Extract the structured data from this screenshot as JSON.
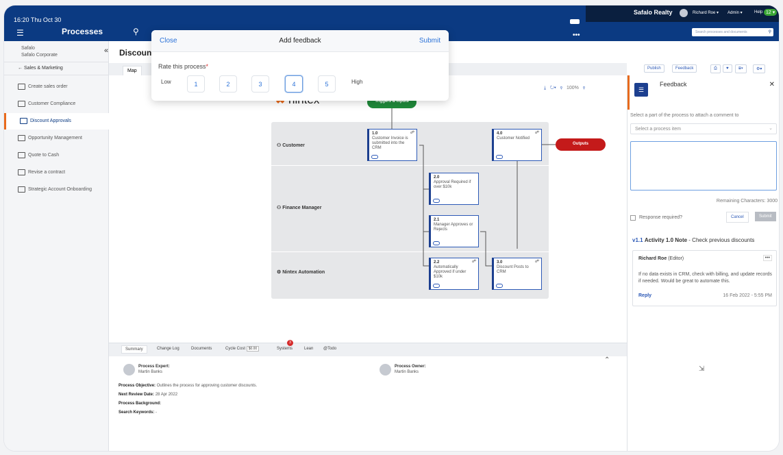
{
  "status_bar": {
    "clock": "16:20 Thu Oct 30"
  },
  "header": {
    "title": "Processes",
    "company": "Safalo Realty",
    "user_menu": "Richard Roe ▾",
    "admin_menu": "Admin ▾",
    "help_menu": "Help",
    "help_count": "12 ▾",
    "search_placeholder": "Search processes and documents"
  },
  "sidebar": {
    "org_name": "Safalo",
    "org_sub": "Safalo Corporate",
    "back_label": "Sales & Marketing",
    "items": [
      {
        "label": "Create sales order"
      },
      {
        "label": "Customer Compliance"
      },
      {
        "label": "Discount Approvals"
      },
      {
        "label": "Opportunity Management"
      },
      {
        "label": "Quote to Cash"
      },
      {
        "label": "Revise a contract"
      },
      {
        "label": "Strategic Account Onboarding"
      }
    ]
  },
  "page": {
    "title": "Discoun",
    "tab_map": "Map"
  },
  "map_toolbar": {
    "zoom": "100%"
  },
  "modal": {
    "close": "Close",
    "title": "Add feedback",
    "submit": "Submit",
    "question": "Rate this process",
    "required_mark": "*",
    "low": "Low",
    "high": "High",
    "ratings": [
      "1",
      "2",
      "3",
      "4",
      "5"
    ],
    "selected_rating": 4
  },
  "diagram": {
    "logo": "nintex",
    "triggers": "Triggers & Inputs",
    "outputs": "Outputs",
    "lanes": [
      "Customer",
      "Finance Manager",
      "Nintex Automation"
    ],
    "activities": [
      {
        "num": "1.0",
        "text": "Customer Invoice is submitted into the CRM"
      },
      {
        "num": "4.0",
        "text": "Customer Notified"
      },
      {
        "num": "2.0",
        "text": "Approval Required if over $10k"
      },
      {
        "num": "2.1",
        "text": "Manager Approves or Rejects"
      },
      {
        "num": "2.2",
        "text": "Automatically Approved if under $10k"
      },
      {
        "num": "3.0",
        "text": "Discount Posts to CRM"
      }
    ]
  },
  "bottom": {
    "tabs": [
      "Summary",
      "Change Log",
      "Documents",
      "Cycle Cost",
      "Systems",
      "Lean",
      "@Todo"
    ],
    "cycle_cost": "$0.00",
    "systems_count": "3",
    "expert_label": "Process Expert:",
    "expert_name": "Martin Banks",
    "owner_label": "Process Owner:",
    "owner_name": "Martin Banks",
    "objective_label": "Process Objective:",
    "objective": "Outlines the process for approving customer discounts.",
    "review_label": "Next Review Date:",
    "review_date": "28 Apr 2022",
    "background_label": "Process Background:",
    "keywords_label": "Search Keywords:",
    "keywords": "-"
  },
  "feedback_panel": {
    "publish": "Publish",
    "feedback_btn": "Feedback",
    "title": "Feedback",
    "hint": "Select a part of the process to attach a comment to",
    "select_placeholder": "Select a process item",
    "remaining": "Remaining Characters: 3000",
    "response_required": "Response required?",
    "cancel": "Cancel",
    "submit": "Submit",
    "note_version": "v1.1",
    "note_title": "Activity 1.0 Note",
    "note_suffix": "- Check previous discounts",
    "comment_author": "Richard Roe",
    "comment_role": "(Editor)",
    "comment_text": "If no data exists in CRM, check with billing, and update records if needed. Would be great to automate this.",
    "reply": "Reply",
    "comment_date": "16 Feb 2022 - 5:55 PM"
  },
  "colors": {
    "brand": "#0b3a82",
    "accent": "#e86a1c",
    "link": "#2b72d8"
  }
}
